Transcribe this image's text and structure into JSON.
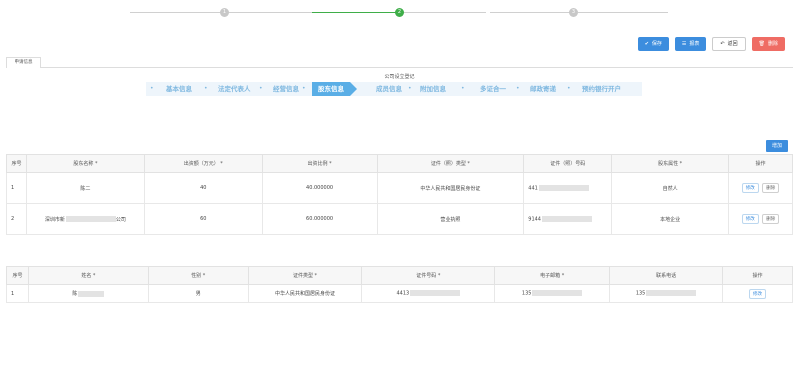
{
  "stepper": {
    "steps": [
      "1",
      "2",
      "3"
    ],
    "active_index": 1
  },
  "actions": {
    "save": "保存",
    "report": "报表",
    "back": "返回",
    "delete": "删除"
  },
  "tab": {
    "label": "申请信息"
  },
  "subtitle": "公司设立登记",
  "process": {
    "steps": [
      "基本信息",
      "法定代表人",
      "经营信息",
      "股东信息",
      "成员信息",
      "附加信息",
      "多证合一",
      "邮政寄递",
      "预约银行开户"
    ],
    "active_index": 3
  },
  "shareholders": {
    "add_label": "增加",
    "headers": [
      "序号",
      "股东名称 *",
      "出资额（万元） *",
      "出资比例 *",
      "证件（照）类型 *",
      "证件（照）号码",
      "股东属性 *",
      "操作"
    ],
    "rows": [
      {
        "no": "1",
        "name": "陈二",
        "amount": "40",
        "ratio": "40.000000",
        "id_type": "中华人民共和国居民身份证",
        "id_no": "441",
        "attr": "自然人",
        "edit": "修改",
        "del": "删除"
      },
      {
        "no": "2",
        "name": "深圳市新",
        "name_suffix": "公司",
        "amount": "60",
        "ratio": "60.000000",
        "id_type": "营业执照",
        "id_no": "9144",
        "attr": "本地企业",
        "edit": "修改",
        "del": "删除"
      }
    ]
  },
  "members": {
    "headers": [
      "序号",
      "姓名 *",
      "性别 *",
      "证件类型 *",
      "证件号码 *",
      "电子邮箱 *",
      "联系电话",
      "操作"
    ],
    "rows": [
      {
        "no": "1",
        "name": "陈",
        "gender": "男",
        "id_type": "中华人民共和国居民身份证",
        "id_no": "4413",
        "email": "135",
        "phone": "135",
        "edit": "修改"
      }
    ]
  }
}
